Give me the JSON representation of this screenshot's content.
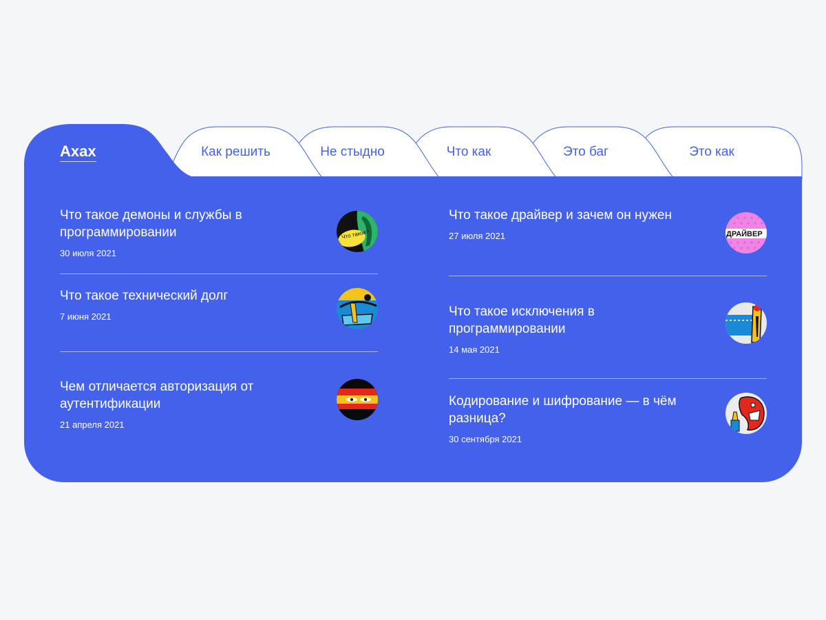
{
  "tabs": {
    "active": "Ахах",
    "items": [
      "Как решить",
      "Не стыдно",
      "Что как",
      "Это баг",
      "Это как"
    ]
  },
  "colors": {
    "accent": "#4361eb",
    "background": "#f4f6f9",
    "text_on_accent": "#ffffff"
  },
  "articles": {
    "left": [
      {
        "title": "Что такое демоны и службы в программировании",
        "date": "30 июля 2021",
        "thumb_icon": "comic-question-icon"
      },
      {
        "title": "Что такое технический долг",
        "date": "7 июня 2021",
        "thumb_icon": "comic-debt-icon"
      },
      {
        "title": "Чем отличается авторизация от аутентификации",
        "date": "21 апреля 2021",
        "thumb_icon": "masked-face-icon"
      }
    ],
    "right": [
      {
        "title": "Что такое драйвер и зачем он нужен",
        "date": "27 июля 2021",
        "thumb_icon": "driver-text-icon"
      },
      {
        "title": "Что такое исключения в программировании",
        "date": "14 мая 2021",
        "thumb_icon": "comic-figure-icon"
      },
      {
        "title": "Кодирование и шифрование — в чём разница?",
        "date": "30 сентября 2021",
        "thumb_icon": "shouting-face-icon"
      }
    ]
  },
  "thumb_texts": {
    "question": "Что такое?",
    "driver": "ДРАЙВЕР"
  }
}
